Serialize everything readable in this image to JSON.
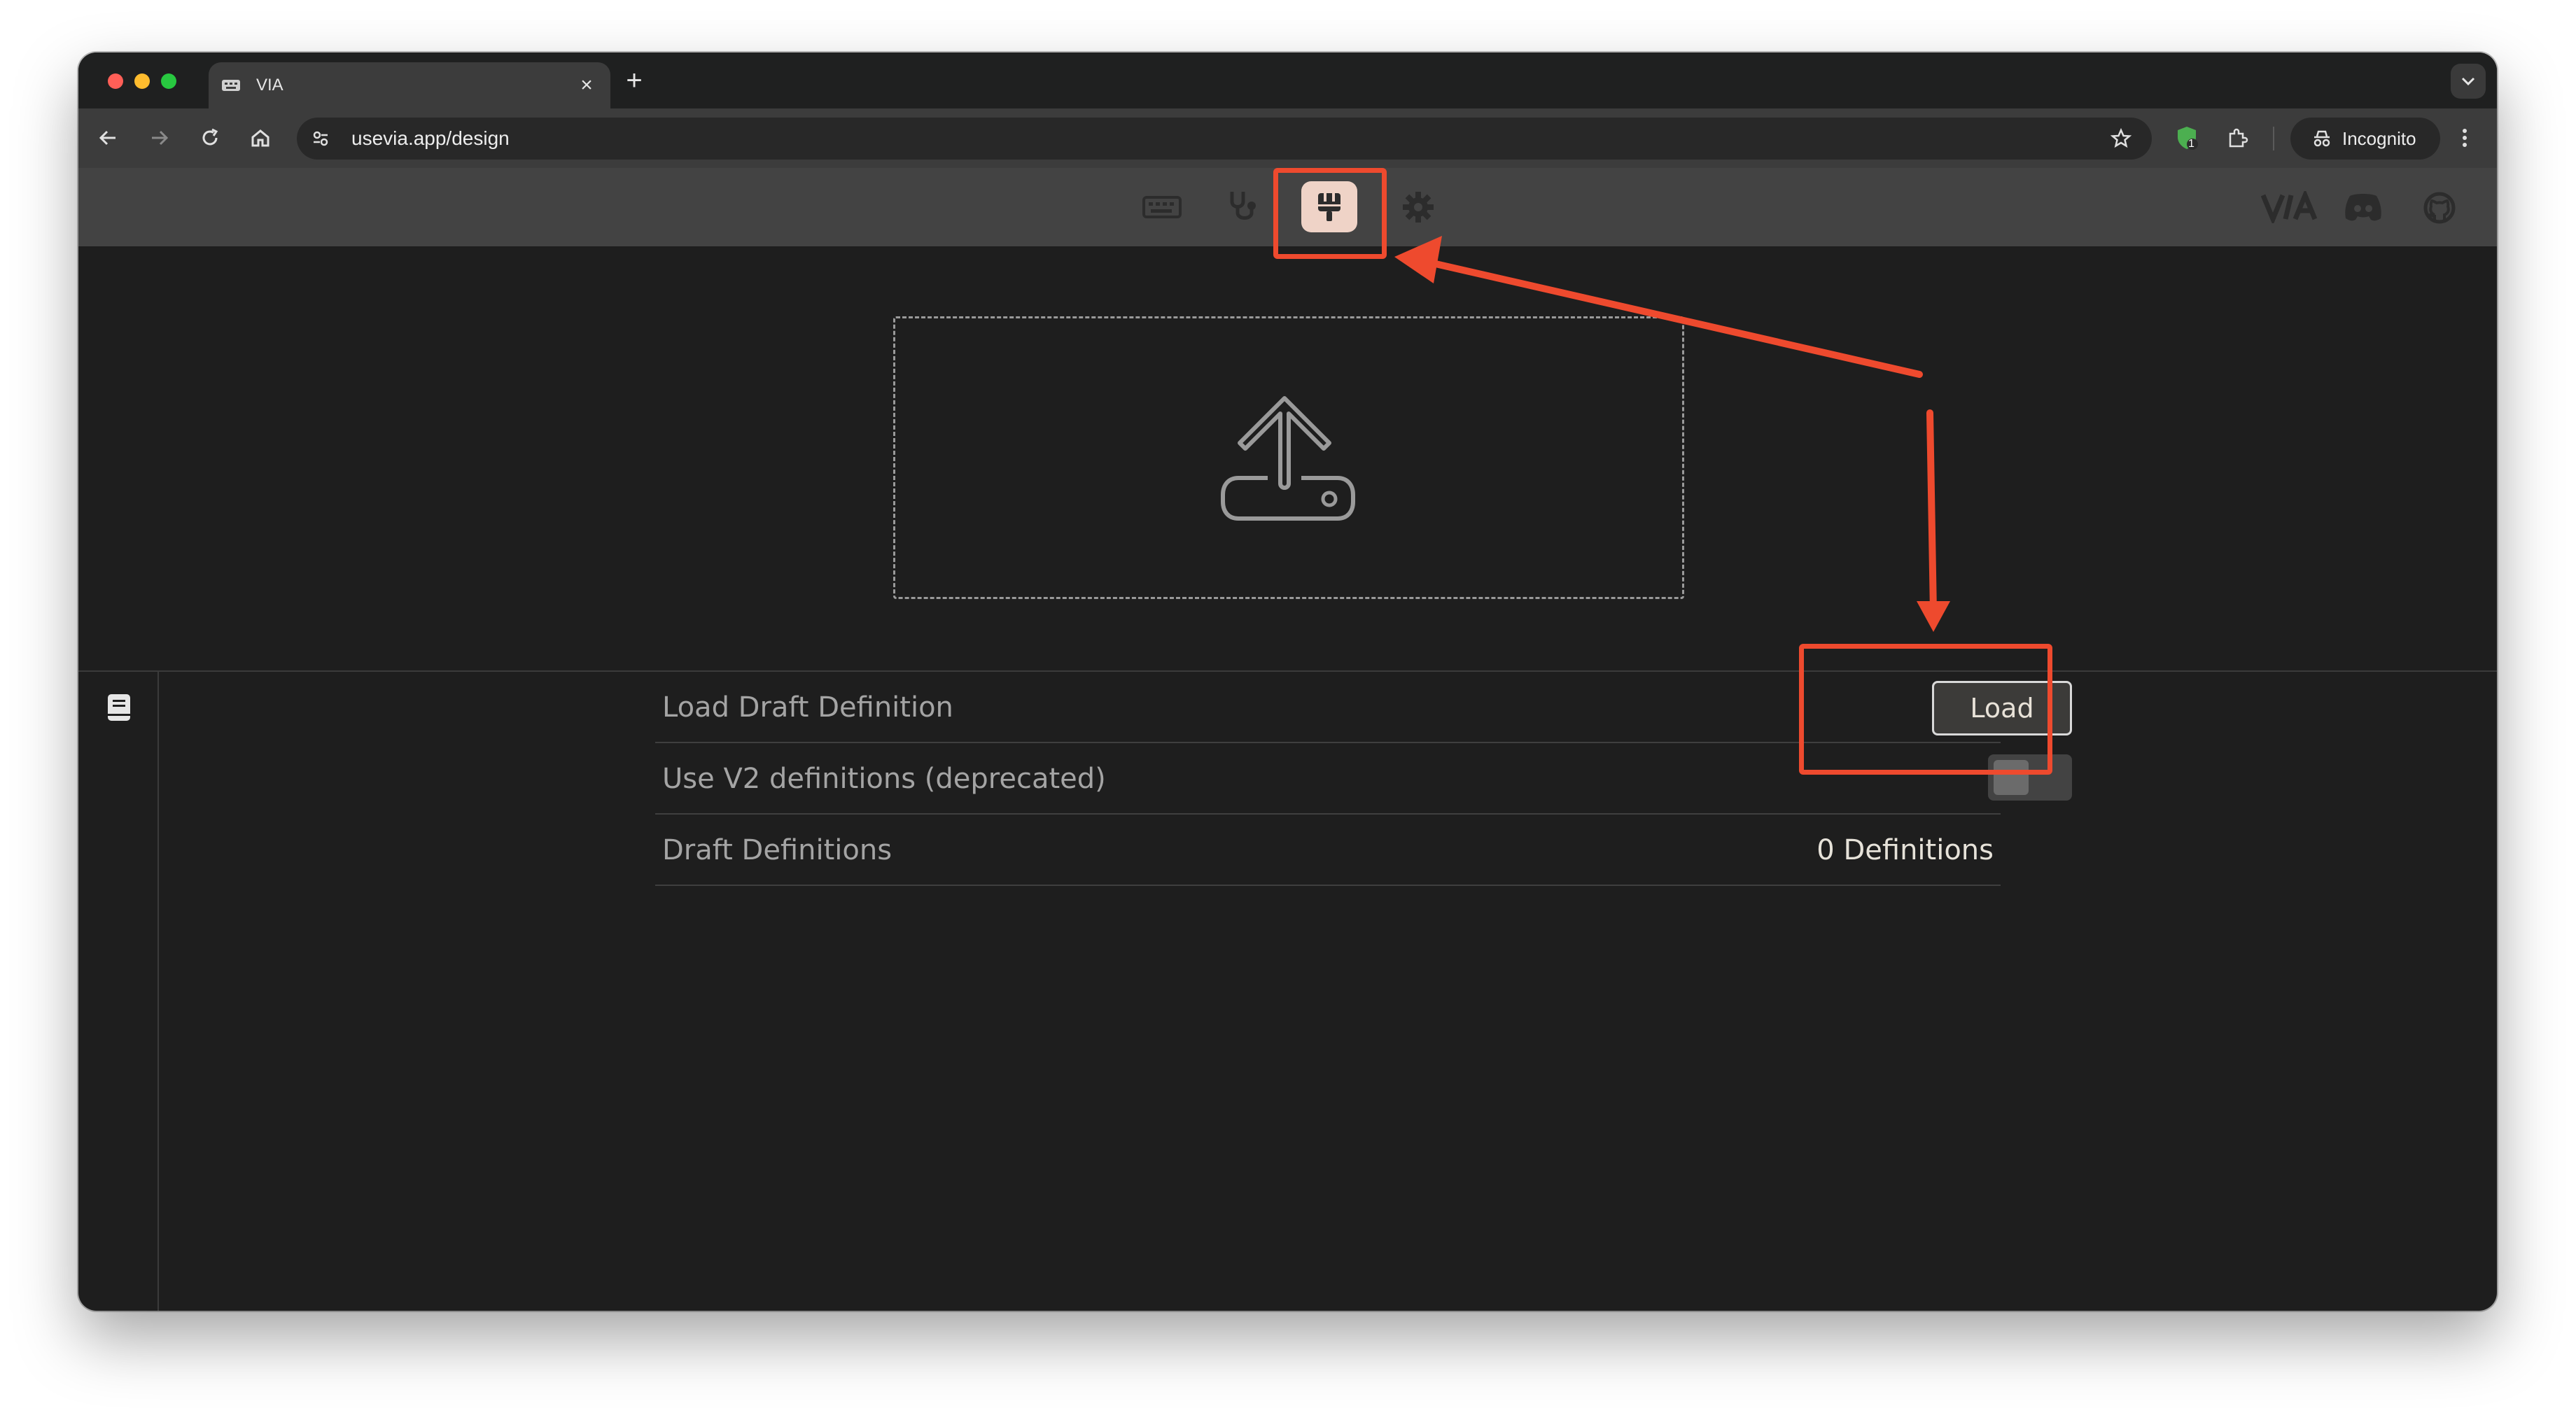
{
  "browser": {
    "tab_title": "VIA",
    "url": "usevia.app/design",
    "incognito_label": "Incognito",
    "extension_badge": "1"
  },
  "app_nav": {
    "icons": [
      "keyboard-icon",
      "stethoscope-icon",
      "paintbrush-icon",
      "gear-icon"
    ],
    "active": "paintbrush-icon",
    "right_icons": [
      "via-logo",
      "discord-icon",
      "github-icon"
    ],
    "accent_color": "#efd3c7"
  },
  "dropzone": {
    "icon": "upload-icon"
  },
  "settings": {
    "rows": [
      {
        "label": "Load Draft Definition",
        "control": "button",
        "button_label": "Load"
      },
      {
        "label": "Use V2 definitions (deprecated)",
        "control": "toggle",
        "value": false
      },
      {
        "label": "Draft Definitions",
        "control": "text",
        "value": "0 Definitions"
      }
    ]
  },
  "annotations": {
    "color": "#ee4a2e"
  }
}
